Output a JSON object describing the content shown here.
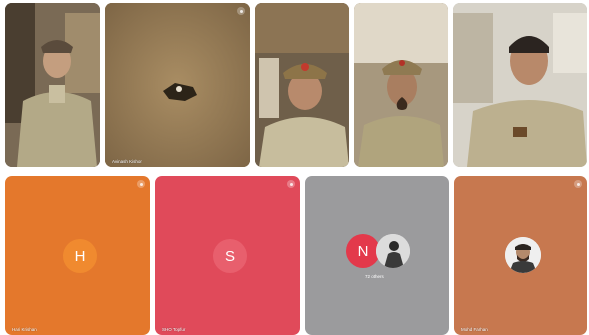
{
  "meeting": {
    "participants": [
      {
        "id": "p1",
        "name": "",
        "kind": "video",
        "uniform": "light"
      },
      {
        "id": "p2",
        "name": "Avinash Kishor",
        "kind": "video-dark"
      },
      {
        "id": "p3",
        "name": "",
        "kind": "video",
        "uniform": "cap"
      },
      {
        "id": "p4",
        "name": "",
        "kind": "video",
        "uniform": "cap"
      },
      {
        "id": "p5",
        "name": "",
        "kind": "video",
        "uniform": "light"
      },
      {
        "id": "p6",
        "name": "Hari Krishan",
        "kind": "avatar",
        "initial": "H",
        "tile_color": "#e4782c",
        "avatar_color": "#f08a2f"
      },
      {
        "id": "p7",
        "name": "SHO Topfur",
        "kind": "avatar",
        "initial": "S",
        "tile_color": "#e04a5a",
        "avatar_color": "#e85f6d"
      },
      {
        "id": "p8",
        "name": "",
        "kind": "group",
        "initial": "N",
        "tile_color": "#9b9b9d",
        "avatar_color": "#e3394b",
        "label": "72 others"
      },
      {
        "id": "p9",
        "name": "Mohd Farhan",
        "kind": "photo-avatar",
        "tile_color": "#c7784f"
      }
    ]
  },
  "colors": {
    "background": "#ffffff",
    "video_bg_warm": "#9a7e55",
    "uniform": "#b7ad8b"
  }
}
